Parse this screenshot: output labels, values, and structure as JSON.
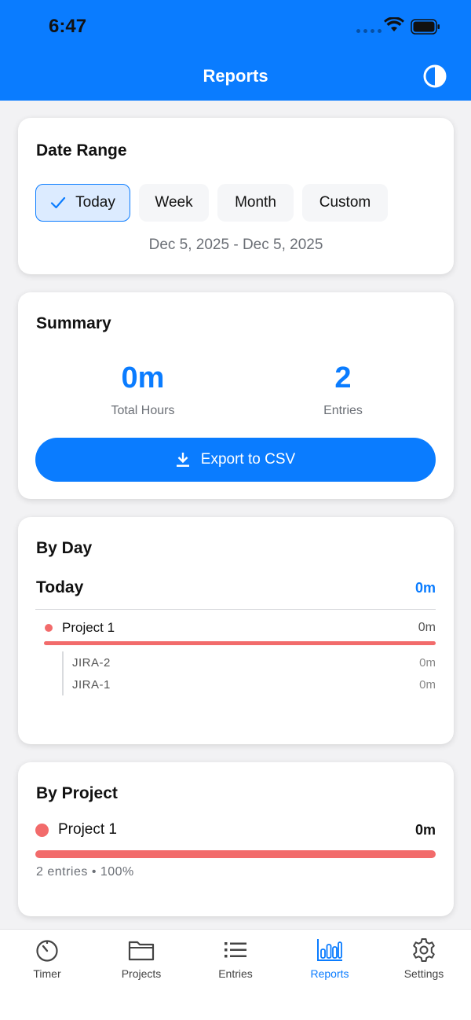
{
  "status": {
    "time": "6:47"
  },
  "header": {
    "title": "Reports"
  },
  "date_range": {
    "title": "Date Range",
    "options": [
      "Today",
      "Week",
      "Month",
      "Custom"
    ],
    "selected": "Today",
    "range_text": "Dec 5, 2025 - Dec 5, 2025"
  },
  "summary": {
    "title": "Summary",
    "total_hours": "0m",
    "total_hours_label": "Total Hours",
    "entries": "2",
    "entries_label": "Entries",
    "export_label": "Export to CSV"
  },
  "by_day": {
    "title": "By Day",
    "day_label": "Today",
    "day_total": "0m",
    "project": {
      "name": "Project 1",
      "time": "0m",
      "color": "#f26b6b"
    },
    "tasks": [
      {
        "name": "JIRA-2",
        "time": "0m"
      },
      {
        "name": "JIRA-1",
        "time": "0m"
      }
    ]
  },
  "by_project": {
    "title": "By Project",
    "project": {
      "name": "Project 1",
      "time": "0m",
      "meta": "2 entries • 100%",
      "share": 1.0,
      "color": "#f26b6b"
    }
  },
  "tabs": [
    {
      "label": "Timer",
      "icon": "timer-icon"
    },
    {
      "label": "Projects",
      "icon": "folder-icon"
    },
    {
      "label": "Entries",
      "icon": "list-icon"
    },
    {
      "label": "Reports",
      "icon": "bar-chart-icon",
      "active": true
    },
    {
      "label": "Settings",
      "icon": "gear-icon"
    }
  ],
  "colors": {
    "accent": "#0a7cff",
    "project": "#f26b6b"
  }
}
